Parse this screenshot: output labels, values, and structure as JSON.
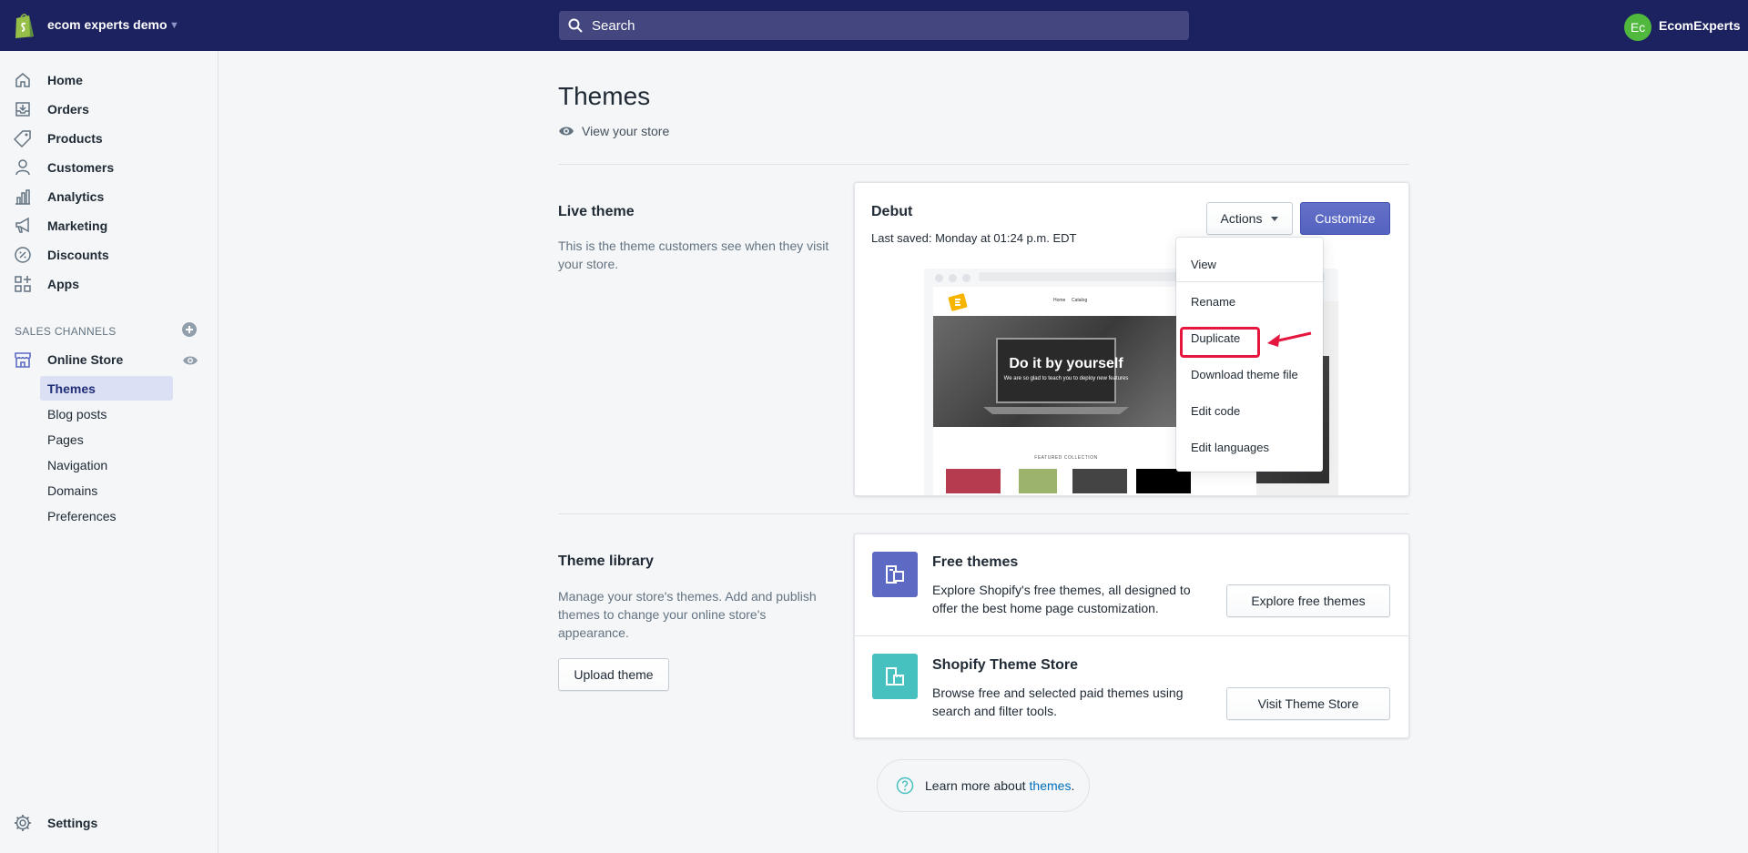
{
  "topbar": {
    "store_name": "ecom experts demo",
    "search_placeholder": "Search",
    "user_initials": "Ec",
    "user_name": "EcomExperts"
  },
  "sidebar": {
    "items": [
      {
        "label": "Home",
        "icon": "home-icon"
      },
      {
        "label": "Orders",
        "icon": "orders-icon"
      },
      {
        "label": "Products",
        "icon": "tag-icon"
      },
      {
        "label": "Customers",
        "icon": "person-icon"
      },
      {
        "label": "Analytics",
        "icon": "bar-chart-icon"
      },
      {
        "label": "Marketing",
        "icon": "megaphone-icon"
      },
      {
        "label": "Discounts",
        "icon": "discount-icon"
      },
      {
        "label": "Apps",
        "icon": "apps-icon"
      }
    ],
    "sales_channels_title": "SALES CHANNELS",
    "online_store": "Online Store",
    "sub_items": [
      "Themes",
      "Blog posts",
      "Pages",
      "Navigation",
      "Domains",
      "Preferences"
    ],
    "settings": "Settings"
  },
  "main": {
    "title": "Themes",
    "view_store": "View your store",
    "live_theme": {
      "heading": "Live theme",
      "description": "This is the theme customers see when they visit your store.",
      "theme_name": "Debut",
      "last_saved": "Last saved: Monday at 01:24 p.m. EDT",
      "actions_label": "Actions",
      "customize_label": "Customize",
      "preview": {
        "nav_links": [
          "Home",
          "Catalog"
        ],
        "hero_title": "Do it by yourself",
        "hero_subtitle": "We are so glad to teach you to deploy new features",
        "featured": "FEATURED COLLECTION"
      }
    },
    "actions_menu": [
      "View",
      "Rename",
      "Duplicate",
      "Download theme file",
      "Edit code",
      "Edit languages"
    ],
    "theme_library": {
      "heading": "Theme library",
      "description": "Manage your store's themes. Add and publish themes to change your online store's appearance.",
      "upload_label": "Upload theme",
      "free_themes": {
        "title": "Free themes",
        "description": "Explore Shopify's free themes, all designed to offer the best home page customization.",
        "button": "Explore free themes"
      },
      "theme_store": {
        "title": "Shopify Theme Store",
        "description": "Browse free and selected paid themes using search and filter tools.",
        "button": "Visit Theme Store"
      }
    },
    "learn_more": {
      "text": "Learn more about ",
      "link": "themes",
      "period": "."
    }
  },
  "colors": {
    "topbar": "#1c2260",
    "accent": "#5c6ac4",
    "teal": "#47c1bf",
    "highlight": "#e5173f"
  }
}
